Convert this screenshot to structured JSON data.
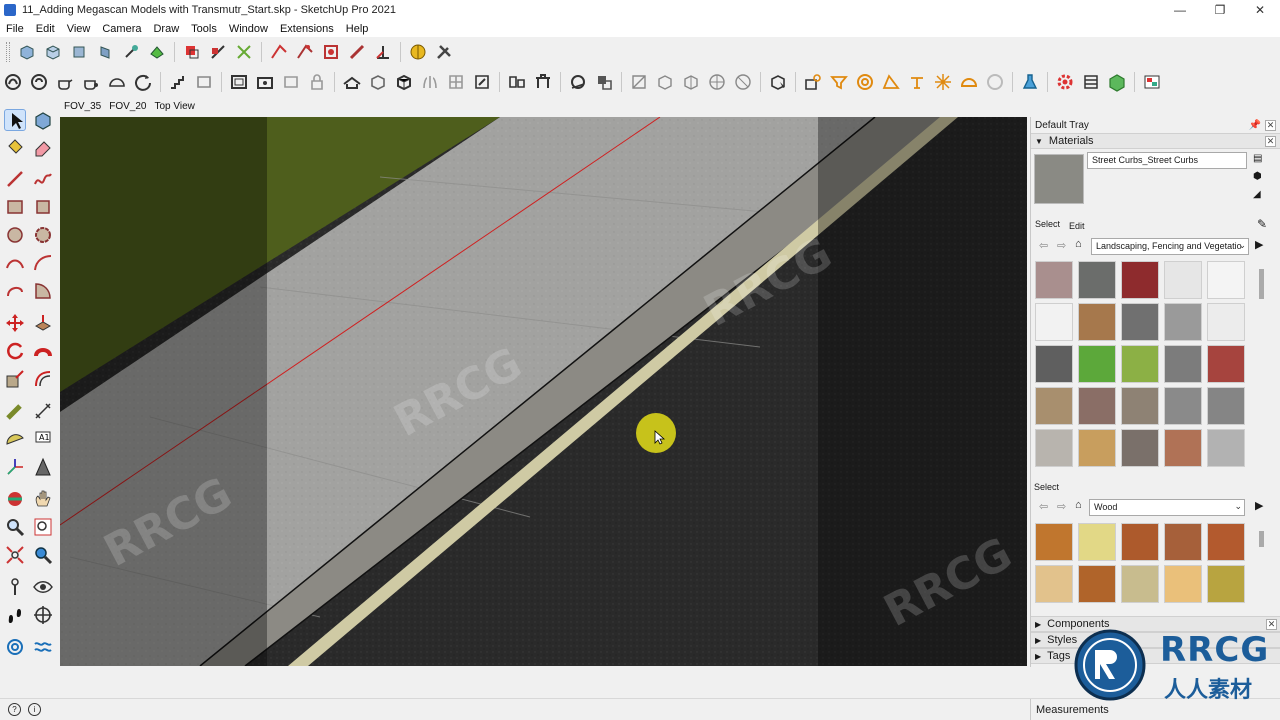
{
  "window": {
    "title": "11_Adding Megascan Models with Transmutr_Start.skp - SketchUp Pro 2021",
    "minimize": "—",
    "maximize": "❐",
    "close": "✕"
  },
  "menubar": {
    "items": [
      "File",
      "Edit",
      "View",
      "Camera",
      "Draw",
      "Tools",
      "Window",
      "Extensions",
      "Help"
    ]
  },
  "scene_tabs": [
    "FOV_35",
    "FOV_20",
    "Top View"
  ],
  "tray": {
    "title": "Default Tray",
    "materials": {
      "header": "Materials",
      "current_material": "Street Curbs_Street Curbs",
      "tab_select": "Select",
      "tab_edit": "Edit",
      "library1": "Landscaping, Fencing and Vegetatio",
      "select2_label": "Select",
      "library2": "Wood"
    },
    "collapsed_panels": [
      "Components",
      "Styles",
      "Tags"
    ]
  },
  "statusbar": {
    "measurements_label": "Measurements",
    "icon1": "?",
    "icon2": "i"
  },
  "logo": {
    "brand": "RRCG",
    "subtitle": "人人素材"
  },
  "watermark_text": "RRCG",
  "colors": {
    "grass": "#4e5e1c",
    "sidewalk": "#9c9c9a",
    "road": "#2a2a2a",
    "road_line": "#cfcaa4",
    "cursor_highlight": "#d8d31a",
    "red_axis": "#d02020"
  }
}
